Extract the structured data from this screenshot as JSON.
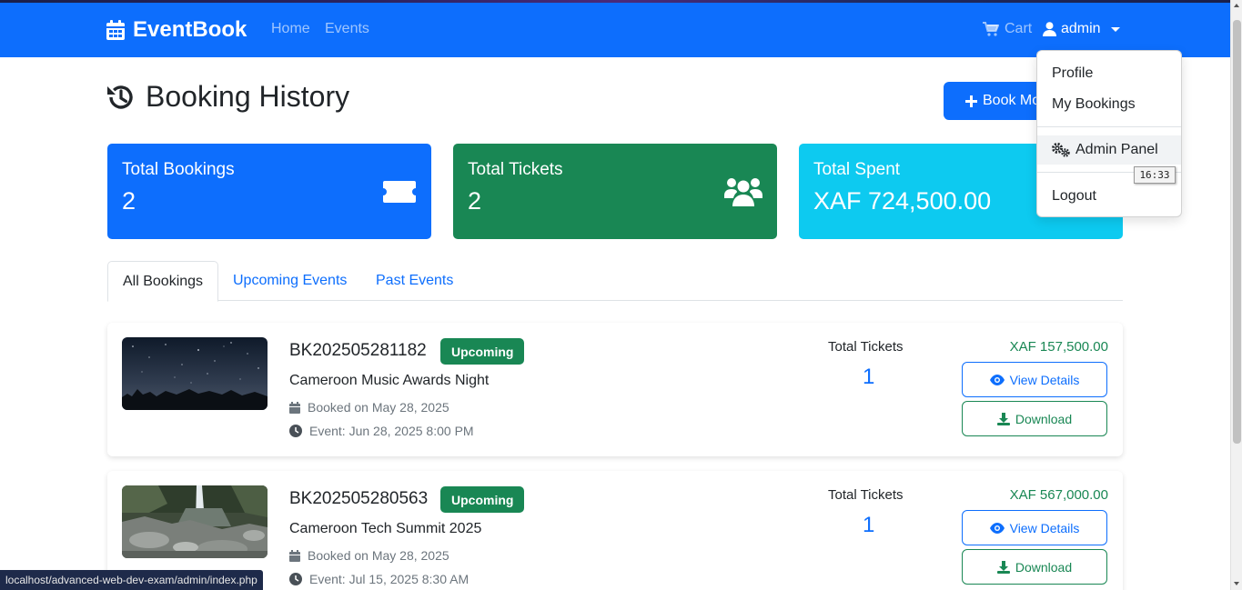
{
  "navbar": {
    "brand": "EventBook",
    "links": {
      "home": "Home",
      "events": "Events",
      "cart": "Cart"
    },
    "user": "admin"
  },
  "page": {
    "title": "Booking History",
    "book_button": "Book More"
  },
  "stats": [
    {
      "label": "Total Bookings",
      "value": "2",
      "icon": "ticket-icon",
      "color": "#0d6efd"
    },
    {
      "label": "Total Tickets",
      "value": "2",
      "icon": "users-icon",
      "color": "#198754"
    },
    {
      "label": "Total Spent",
      "value": "XAF 724,500.00",
      "icon": "money-icon",
      "color": "#0dcaf0"
    }
  ],
  "tabs": [
    {
      "label": "All Bookings",
      "active": true
    },
    {
      "label": "Upcoming Events",
      "active": false
    },
    {
      "label": "Past Events",
      "active": false
    }
  ],
  "bookings": [
    {
      "ref": "BK202505281182",
      "status": "Upcoming",
      "event": "Cameroon Music Awards Night",
      "booked_on": "Booked on May 28, 2025",
      "event_date": "Event: Jun 28, 2025 8:00 PM",
      "tickets_label": "Total Tickets",
      "tickets": "1",
      "price": "XAF 157,500.00",
      "view_label": "View Details",
      "download_label": "Download"
    },
    {
      "ref": "BK202505280563",
      "status": "Upcoming",
      "event": "Cameroon Tech Summit 2025",
      "booked_on": "Booked on May 28, 2025",
      "event_date": "Event: Jul 15, 2025 8:30 AM",
      "tickets_label": "Total Tickets",
      "tickets": "1",
      "price": "XAF 567,000.00",
      "view_label": "View Details",
      "download_label": "Download"
    }
  ],
  "dropdown": {
    "items": [
      "Profile",
      "My Bookings",
      "Admin Panel",
      "Logout"
    ]
  },
  "tooltip_time": "16:33",
  "status_url": "localhost/advanced-web-dev-exam/admin/index.php",
  "colors": {
    "primary": "#0d6efd",
    "success": "#198754",
    "info": "#0dcaf0"
  }
}
